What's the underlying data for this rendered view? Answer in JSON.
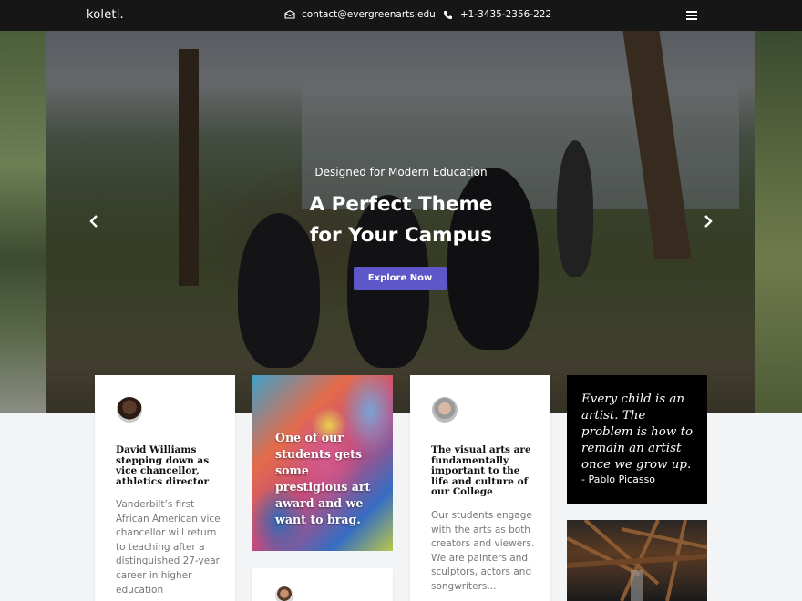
{
  "header": {
    "logo": "koleti.",
    "email": "contact@evergreenarts.edu",
    "phone": "+1-3435-2356-222",
    "icons": {
      "email": "envelope-icon",
      "phone": "phone-icon",
      "menu": "hamburger-menu-icon"
    }
  },
  "hero": {
    "subtitle": "Designed for Modern Education",
    "title_line1": "A Perfect Theme",
    "title_line2": "for Your Campus",
    "button_label": "Explore Now",
    "prev_icon": "chevron-left-icon",
    "next_icon": "chevron-right-icon"
  },
  "cards": {
    "news1": {
      "title": "David Williams stepping down as vice chancellor, athletics director",
      "body": "Vanderbilt’s first African American vice chancellor will return to teaching after a distinguished 27-year career in higher education"
    },
    "art": {
      "text": "One of our students gets some prestigious art award and we want to brag."
    },
    "news2": {
      "title": "The visual arts are fundamentally important to the life and culture of our College",
      "body": "Our students engage with the arts as both creators and viewers. We are painters and sculptors, actors and songwriters..."
    },
    "quote": {
      "text": "Every child is an artist. The problem is how to remain an artist once we grow up.",
      "author": "- Pablo Picasso"
    }
  },
  "colors": {
    "accent": "#5d57c9",
    "topbar": "#161616",
    "page_bg": "#f3f4f6"
  }
}
